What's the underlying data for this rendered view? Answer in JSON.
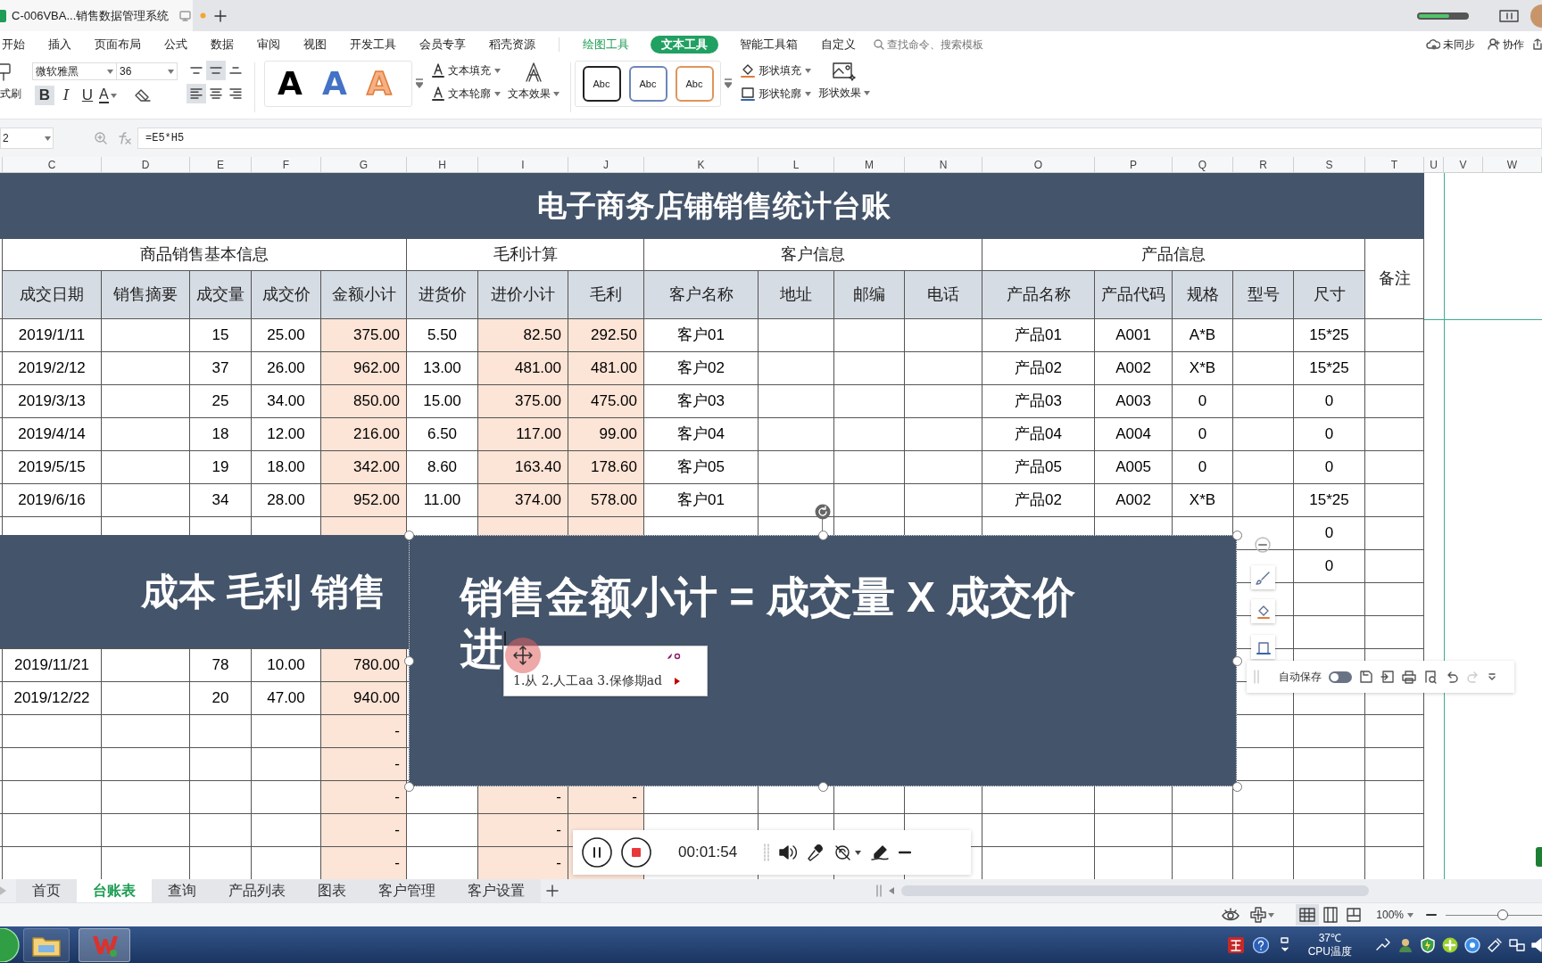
{
  "window": {
    "tab_title": "C-006VBA...销售数据管理系统"
  },
  "menu": [
    {
      "label": "开始",
      "kind": "tab",
      "selected": false
    },
    {
      "label": "插入",
      "kind": "tab",
      "selected": false
    },
    {
      "label": "页面布局",
      "kind": "tab",
      "selected": false
    },
    {
      "label": "公式",
      "kind": "tab",
      "selected": false
    },
    {
      "label": "数据",
      "kind": "tab",
      "selected": false
    },
    {
      "label": "审阅",
      "kind": "tab",
      "selected": false
    },
    {
      "label": "视图",
      "kind": "tab",
      "selected": false
    },
    {
      "label": "开发工具",
      "kind": "tab",
      "selected": false
    },
    {
      "label": "会员专享",
      "kind": "tab",
      "selected": false
    },
    {
      "label": "稻壳资源",
      "kind": "tab",
      "selected": false
    },
    {
      "label": "绘图工具",
      "kind": "context",
      "selected": false
    },
    {
      "label": "文本工具",
      "kind": "context",
      "selected": true
    },
    {
      "label": "智能工具箱",
      "kind": "tab",
      "selected": false
    },
    {
      "label": "自定义",
      "kind": "tab",
      "selected": false
    }
  ],
  "search": {
    "placeholder": "查找命令、搜索模板"
  },
  "account": {
    "sync": "未同步",
    "collab": "协作"
  },
  "ribbon": {
    "painter": "式刷",
    "font": "微软雅黑",
    "size": "36",
    "format_buttons": [
      {
        "label": "B",
        "selected": true
      },
      {
        "label": "I",
        "selected": false
      },
      {
        "label": "U",
        "selected": false
      }
    ],
    "font_color": "A",
    "valign": [
      {
        "kind": "top",
        "selected": false
      },
      {
        "kind": "middle",
        "selected": true
      },
      {
        "kind": "bottom",
        "selected": false
      }
    ],
    "halign": [
      {
        "kind": "left",
        "selected": true
      },
      {
        "kind": "center",
        "selected": false
      },
      {
        "kind": "right",
        "selected": false
      }
    ],
    "text_styles": [
      {
        "sample": "A",
        "kind": "solid"
      },
      {
        "sample": "A",
        "kind": "blue"
      },
      {
        "sample": "A",
        "kind": "outline"
      }
    ],
    "text_fill": "文本填充",
    "text_outline": "文本轮廓",
    "text_effect": "文本效果",
    "shape_styles": [
      {
        "label": "Abc",
        "color": "#222222"
      },
      {
        "label": "Abc",
        "color": "#6b87b8"
      },
      {
        "label": "Abc",
        "color": "#e0955a"
      }
    ],
    "shape_fill": "形状填充",
    "shape_outline": "形状轮廓",
    "shape_effect": "形状效果"
  },
  "formula_bar": {
    "cell": "2",
    "formula": "=E5*H5"
  },
  "columns": [
    "C",
    "D",
    "E",
    "F",
    "G",
    "H",
    "I",
    "J",
    "K",
    "L",
    "M",
    "N",
    "O",
    "P",
    "Q",
    "R",
    "S",
    "T",
    "U",
    "V",
    "W"
  ],
  "sheet": {
    "title": "电子商务店铺销售统计台账",
    "groups": [
      "商品销售基本信息",
      "毛利计算",
      "客户信息",
      "产品信息"
    ],
    "remark": "备注",
    "headers": [
      "成交日期",
      "销售摘要",
      "成交量",
      "成交价",
      "金额小计",
      "进货价",
      "进价小计",
      "毛利",
      "客户名称",
      "地址",
      "邮编",
      "电话",
      "产品名称",
      "产品代码",
      "规格",
      "型号",
      "尺寸"
    ],
    "rows": [
      [
        "2019/1/11",
        null,
        "15",
        "25.00",
        "375.00",
        "5.50",
        "82.50",
        "292.50",
        "客户01",
        null,
        null,
        null,
        "产品01",
        "A001",
        "A*B",
        null,
        "15*25"
      ],
      [
        "2019/2/12",
        null,
        "37",
        "26.00",
        "962.00",
        "13.00",
        "481.00",
        "481.00",
        "客户02",
        null,
        null,
        null,
        "产品02",
        "A002",
        "X*B",
        null,
        "15*25"
      ],
      [
        "2019/3/13",
        null,
        "25",
        "34.00",
        "850.00",
        "15.00",
        "375.00",
        "475.00",
        "客户03",
        null,
        null,
        null,
        "产品03",
        "A003",
        "0",
        null,
        "0"
      ],
      [
        "2019/4/14",
        null,
        "18",
        "12.00",
        "216.00",
        "6.50",
        "117.00",
        "99.00",
        "客户04",
        null,
        null,
        null,
        "产品04",
        "A004",
        "0",
        null,
        "0"
      ],
      [
        "2019/5/15",
        null,
        "19",
        "18.00",
        "342.00",
        "8.60",
        "163.40",
        "178.60",
        "客户05",
        null,
        null,
        null,
        "产品05",
        "A005",
        "0",
        null,
        "0"
      ],
      [
        "2019/6/16",
        null,
        "34",
        "28.00",
        "952.00",
        "11.00",
        "374.00",
        "578.00",
        "客户01",
        null,
        null,
        null,
        "产品02",
        "A002",
        "X*B",
        null,
        "15*25"
      ],
      [
        null,
        null,
        null,
        null,
        null,
        null,
        null,
        null,
        null,
        null,
        null,
        null,
        null,
        null,
        null,
        null,
        "0"
      ],
      [
        null,
        null,
        null,
        null,
        null,
        null,
        null,
        null,
        null,
        null,
        null,
        null,
        null,
        null,
        null,
        null,
        "0"
      ],
      [
        null,
        null,
        null,
        null,
        null,
        null,
        null,
        null,
        null,
        null,
        null,
        null,
        null,
        null,
        null,
        null,
        null
      ],
      [
        null,
        null,
        null,
        null,
        null,
        null,
        null,
        null,
        null,
        null,
        null,
        null,
        null,
        null,
        null,
        null,
        null
      ],
      [
        "2019/11/21",
        null,
        "78",
        "10.00",
        "780.00",
        null,
        null,
        null,
        null,
        null,
        null,
        null,
        null,
        null,
        null,
        null,
        null
      ],
      [
        "2019/12/22",
        null,
        "20",
        "47.00",
        "940.00",
        null,
        null,
        null,
        null,
        null,
        null,
        null,
        null,
        null,
        null,
        null,
        null
      ],
      [
        null,
        null,
        null,
        null,
        "-",
        null,
        null,
        null,
        null,
        null,
        null,
        null,
        null,
        null,
        null,
        null,
        null
      ],
      [
        null,
        null,
        null,
        null,
        "-",
        null,
        null,
        null,
        null,
        null,
        null,
        null,
        null,
        null,
        null,
        null,
        null
      ],
      [
        null,
        null,
        null,
        null,
        "-",
        null,
        "-",
        "-",
        null,
        null,
        null,
        null,
        null,
        null,
        null,
        null,
        null
      ],
      [
        null,
        null,
        null,
        null,
        "-",
        null,
        "-",
        null,
        null,
        null,
        null,
        null,
        null,
        null,
        null,
        null,
        null
      ],
      [
        null,
        null,
        null,
        null,
        "-",
        null,
        "-",
        null,
        null,
        null,
        null,
        null,
        null,
        null,
        null,
        null,
        null
      ]
    ]
  },
  "banner": {
    "text": "成本 毛利 销售"
  },
  "text_box": {
    "line_1": "销售金额小计 = 成交量 X 成交价",
    "line_2": "进"
  },
  "ime": {
    "candidates": "1.从 2.人工aa 3.保修期ad"
  },
  "autosave": {
    "label": "自动保存",
    "on": false
  },
  "recorder": {
    "time": "00:01:54"
  },
  "sheet_tabs": [
    {
      "label": "首页",
      "selected": false
    },
    {
      "label": "台账表",
      "selected": true
    },
    {
      "label": "查询",
      "selected": false
    },
    {
      "label": "产品列表",
      "selected": false
    },
    {
      "label": "图表",
      "selected": false
    },
    {
      "label": "客户管理",
      "selected": false
    },
    {
      "label": "客户设置",
      "selected": false
    }
  ],
  "status": {
    "zoom": "100%",
    "zoom_level": {
      "level": 0.6
    },
    "views": [
      {
        "kind": "normal",
        "selected": true
      },
      {
        "kind": "page_layout",
        "selected": false
      },
      {
        "kind": "page_break",
        "selected": false
      }
    ]
  },
  "taskbar": {
    "temperature": "37℃",
    "sensor": "CPU温度"
  }
}
